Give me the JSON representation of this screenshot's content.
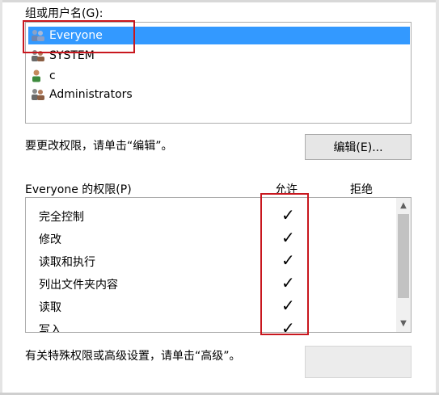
{
  "groups_label": "组或用户名(G):",
  "groups": [
    {
      "label": "Everyone",
      "selected": true,
      "icon": "group-icon"
    },
    {
      "label": "SYSTEM",
      "selected": false,
      "icon": "group-icon"
    },
    {
      "label": "c",
      "selected": false,
      "icon": "user-icon"
    },
    {
      "label": "Administrators",
      "selected": false,
      "icon": "group-icon"
    }
  ],
  "edit_hint": "要更改权限，请单击“编辑”。",
  "edit_button": "编辑(E)...",
  "perm_title": "Everyone 的权限(P)",
  "col_allow": "允许",
  "col_deny": "拒绝",
  "permissions": [
    {
      "name": "完全控制",
      "allow": "✓"
    },
    {
      "name": "修改",
      "allow": "✓"
    },
    {
      "name": "读取和执行",
      "allow": "✓"
    },
    {
      "name": "列出文件夹内容",
      "allow": "✓"
    },
    {
      "name": "读取",
      "allow": "✓"
    },
    {
      "name": "写入",
      "allow": "✓"
    }
  ],
  "advanced_hint": "有关特殊权限或高级设置，请单击“高级”。",
  "colors": {
    "selection": "#3399ff",
    "annotation": "#c8171e"
  }
}
